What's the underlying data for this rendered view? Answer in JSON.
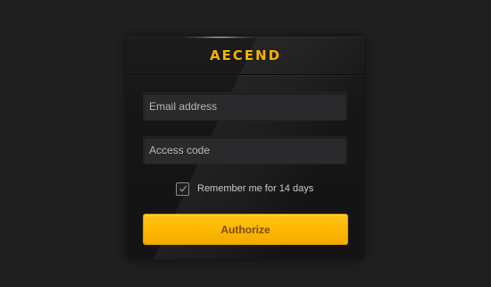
{
  "brand": {
    "logo_text": "AECEND",
    "accent_color": "#f4b400"
  },
  "form": {
    "email_placeholder": "Email address",
    "email_value": "",
    "code_placeholder": "Access code",
    "code_value": "",
    "remember": {
      "label": "Remember me for 14 days",
      "checked": true,
      "icon": "checkmark-icon"
    },
    "submit_label": "Authorize",
    "submit_color": "#fdb700"
  }
}
